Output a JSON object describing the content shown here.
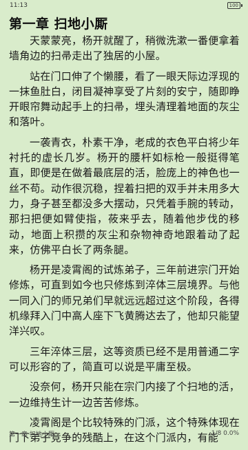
{
  "status_bar": {
    "time": "11:13",
    "battery": "100"
  },
  "chapter": {
    "title": "第一章 扫地小厮"
  },
  "paragraphs": [
    "天蒙蒙亮，杨开就醒了，稍微洗漱一番便拿着墙角边的扫帚走出了独居的小屋。",
    "站在门口伸了个懒腰，看了一眼天际边浮现的一抹鱼肚白，闭目凝神享受了片刻的安宁，随即睁开眼帘舞动起手上的扫帚，埋头清理着地面的灰尘和落叶。",
    "一袭青衣，朴素干净，老成的衣色平白将少年衬托的虚长几岁。杨开的腰杆如标枪一般挺得笔直，即便是在做着最底层的活，脸庞上的神色也一丝不苟。动作很沉稳，捏着扫把的双手并未用多大力，身子甚至都没多大摆动，只凭着手腕的转动，那扫把便如臂使指，莜来乎去，随着他步伐的移动，地面上积攒的灰尘和杂物神奇地跟着动了起来，仿佛平白长了两条腿。",
    "杨开是凌霄阁的试炼弟子，三年前进宗门开始修炼，可直到如今也只修炼到淬体三层境界。与他一同入门的师兄弟们早就远远超过这个阶段，各得机缘拜入门中高人座下飞黄腾达去了，他却只能望洋兴叹。",
    "三年淬体三层，这等资质已经不是用普通二字可以形容的了，简直可以说是平庸至极。",
    "没奈何，杨开只能在宗门内接了个扫地的活，一边维持生计一边苦苦修炼。",
    "凌霄阁是个比较特殊的门派，这个特殊体现在门下弟子竞争的残酷上，在这个门派内，有能"
  ],
  "footer": {
    "chapter_name": "第一章 扫地小厮",
    "progress": "1/8  0.0%"
  }
}
